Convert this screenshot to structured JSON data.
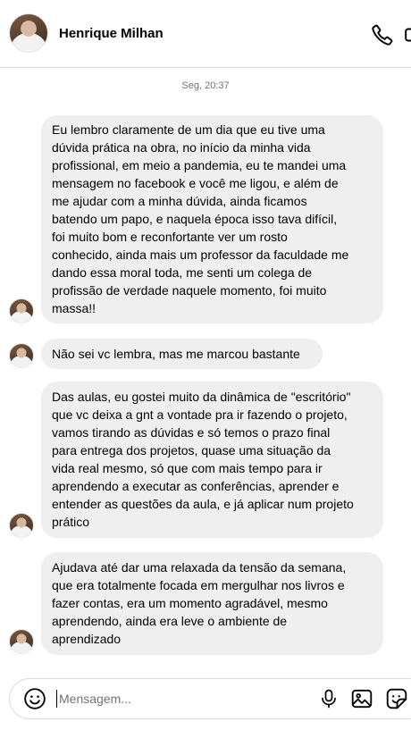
{
  "header": {
    "contact_name": "Henrique Milhan",
    "call_icon": "phone-icon",
    "video_icon": "video-camera-icon",
    "avatar_icon": "profile-photo"
  },
  "thread": {
    "timestamp": "Seg, 20:37",
    "messages": [
      {
        "lines": [
          "Eu lembro claramente de um dia que eu tive uma",
          "dúvida prática na obra, no início da minha vida",
          "profissional, em meio a pandemia, eu te mandei uma",
          "mensagem no facebook e você me ligou, e além de",
          "me ajudar com a minha dúvida, ainda ficamos",
          "batendo um papo, e naquela época isso tava difícil,",
          "foi muito bom e reconfortante ver um rosto",
          "conhecido, ainda mais um professor da faculdade me",
          "dando essa moral toda, me senti um colega de",
          "profissão de verdade naquele momento, foi muito",
          "massa!!"
        ]
      },
      {
        "lines": [
          "Não sei vc lembra, mas me marcou bastante"
        ]
      },
      {
        "lines": [
          "Das aulas, eu gostei muito da dinâmica de \"escritório\"",
          "que vc deixa a gnt a vontade pra ir fazendo o projeto,",
          "vamos tirando as dúvidas e só temos o prazo final",
          "para entrega dos projetos, quase uma situação da",
          "vida real mesmo, só que com mais tempo para ir",
          "aprendendo a executar as conferências, aprender e",
          "entender as questões da aula, e já aplicar num projeto",
          "prático"
        ]
      },
      {
        "lines": [
          "Ajudava até dar uma relaxada da tensão da semana,",
          "que era totalmente focada em mergulhar nos livros e",
          "fazer contas, era um momento agradável, mesmo",
          "aprendendo, ainda era leve o ambiente de",
          "aprendizado"
        ]
      }
    ]
  },
  "composer": {
    "placeholder": "Mensagem...",
    "value": "",
    "emoji_icon": "emoji-icon",
    "mic_icon": "microphone-icon",
    "image_icon": "image-icon",
    "sticker_icon": "sticker-icon"
  },
  "colors": {
    "bubble_bg": "#efefef",
    "divider": "#dbdbdb",
    "muted_text": "#737373"
  }
}
